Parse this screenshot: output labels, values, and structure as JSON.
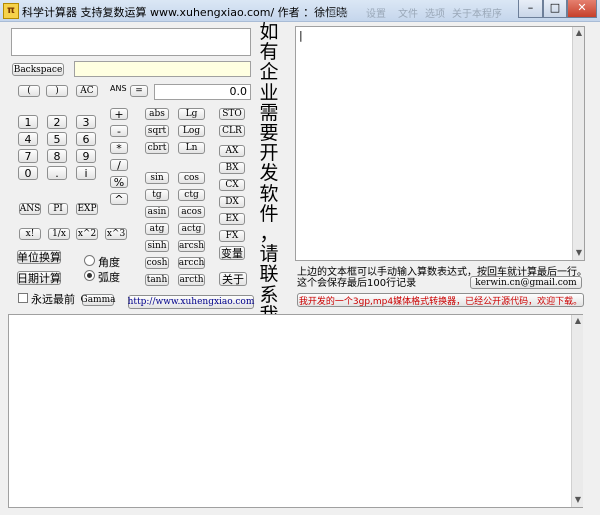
{
  "window": {
    "icon_text": "π",
    "title": "科学计算器  支持复数运算 www.xuhengxiao.com/   作者 ：徐恒晓",
    "faint_menu": [
      "帮助",
      "设置",
      "文件",
      "选项",
      "关于本程序"
    ],
    "controls": {
      "minimize": "–",
      "maximize": "□",
      "close": "✕"
    }
  },
  "calc": {
    "expression_value": "",
    "backspace_label": "Backspace",
    "result_value": "",
    "lparen_label": "(",
    "rparen_label": ")",
    "ac_label": "AC",
    "ans_label": "ANS",
    "equals_label": "=",
    "ans_value": "0.0",
    "digits": [
      "1",
      "2",
      "3",
      "4",
      "5",
      "6",
      "7",
      "8",
      "9",
      "0",
      ".",
      "i"
    ],
    "operators": [
      "+",
      "-",
      "*",
      "/",
      "%",
      "^"
    ],
    "functions": [
      "abs",
      "Lg",
      "sqrt",
      "Log",
      "cbrt",
      "Ln",
      "sin",
      "cos",
      "tg",
      "ctg",
      "asin",
      "acos",
      "atg",
      "actg",
      "sinh",
      "arcsh",
      "cosh",
      "arcch",
      "tanh",
      "arcth"
    ],
    "memory": [
      "STO",
      "CLR",
      "AX",
      "BX",
      "CX",
      "DX",
      "EX",
      "FX"
    ],
    "change_label": "变量",
    "constants": [
      "ANS",
      "PI",
      "EXP"
    ],
    "powers": [
      "x!",
      "1/x",
      "x^2",
      "x^3"
    ],
    "unit_convert_label": "单位换算",
    "date_calc_label": "日期计算",
    "angle_label": "角度",
    "radian_label": "弧度",
    "always_on_top_label": "永远最前",
    "gamma_label": "Gamma",
    "url_label": "http://www.xuhengxiao.com",
    "about_label": "关于"
  },
  "ad_vertical": [
    "如",
    "有",
    "企",
    "业",
    "需",
    "要",
    "开",
    "发",
    "软",
    "件",
    "，",
    "请",
    "联",
    "系",
    "我"
  ],
  "editor": {
    "content": "|",
    "hint_line1": "上边的文本框可以手动输入算数表达式，按回车就计算最后一行。",
    "hint_line2": "这个会保存最后100行记录",
    "email_label": "kerwin.cn@gmail.com",
    "promo_label": "我开发的一个3gp,mp4媒体格式转换器，已经公开源代码，欢迎下载。"
  },
  "colors": {
    "result_bg": "#ffffe1",
    "promo_text": "#cc0000",
    "url_text": "#00008b"
  }
}
